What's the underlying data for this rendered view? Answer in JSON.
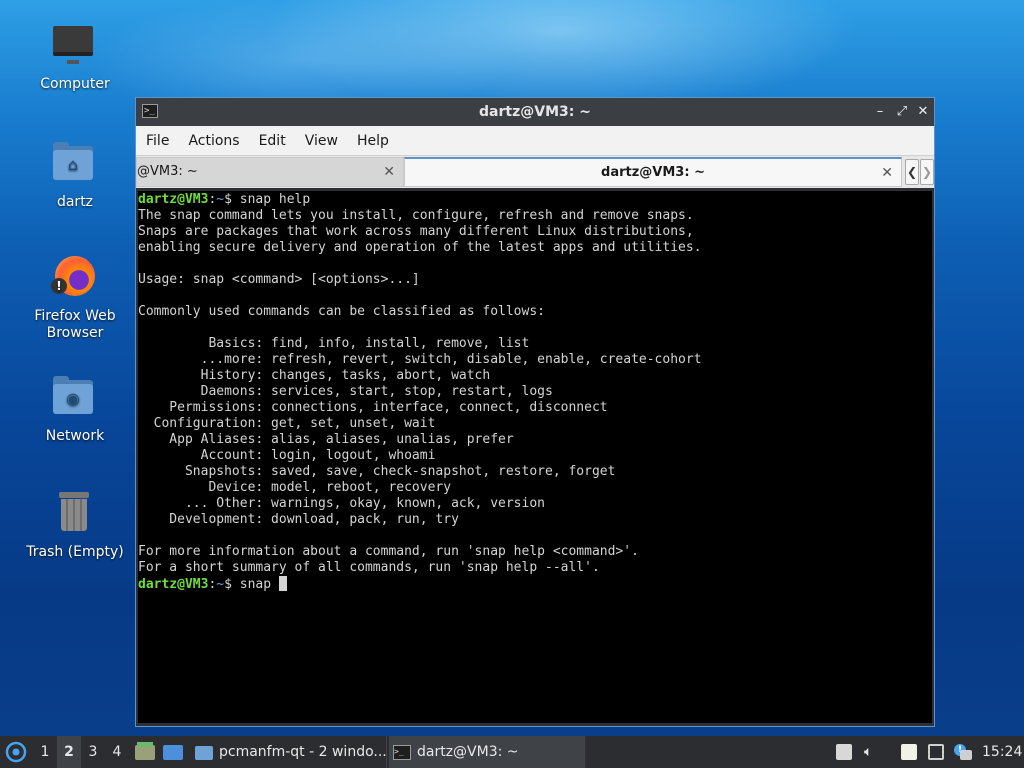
{
  "desktop": {
    "icons": [
      {
        "label": "Computer"
      },
      {
        "label": "dartz"
      },
      {
        "label": "Firefox Web Browser"
      },
      {
        "label": "Network"
      },
      {
        "label": "Trash (Empty)"
      }
    ]
  },
  "window": {
    "title": "dartz@VM3: ~",
    "menu": [
      "File",
      "Actions",
      "Edit",
      "View",
      "Help"
    ],
    "tabs": [
      {
        "label": "@VM3: ~"
      },
      {
        "label": "dartz@VM3: ~"
      }
    ],
    "terminal": {
      "prompt_user": "dartz@VM3",
      "prompt_sep": ":",
      "prompt_path": "~",
      "prompt_end": "$ ",
      "command1": "snap help",
      "output": [
        "The snap command lets you install, configure, refresh and remove snaps.",
        "Snaps are packages that work across many different Linux distributions,",
        "enabling secure delivery and operation of the latest apps and utilities.",
        "",
        "Usage: snap <command> [<options>...]",
        "",
        "Commonly used commands can be classified as follows:",
        "",
        "         Basics: find, info, install, remove, list",
        "        ...more: refresh, revert, switch, disable, enable, create-cohort",
        "        History: changes, tasks, abort, watch",
        "        Daemons: services, start, stop, restart, logs",
        "    Permissions: connections, interface, connect, disconnect",
        "  Configuration: get, set, unset, wait",
        "    App Aliases: alias, aliases, unalias, prefer",
        "        Account: login, logout, whoami",
        "      Snapshots: saved, save, check-snapshot, restore, forget",
        "         Device: model, reboot, recovery",
        "      ... Other: warnings, okay, known, ack, version",
        "    Development: download, pack, run, try",
        "",
        "For more information about a command, run 'snap help <command>'.",
        "For a short summary of all commands, run 'snap help --all'."
      ],
      "command2": "snap "
    }
  },
  "taskbar": {
    "desktops": [
      "1",
      "2",
      "3",
      "4"
    ],
    "active_desktop": "2",
    "tasks": [
      {
        "label": "pcmanfm-qt - 2 windo..."
      },
      {
        "label": "dartz@VM3: ~"
      }
    ],
    "clock": "15:24"
  }
}
